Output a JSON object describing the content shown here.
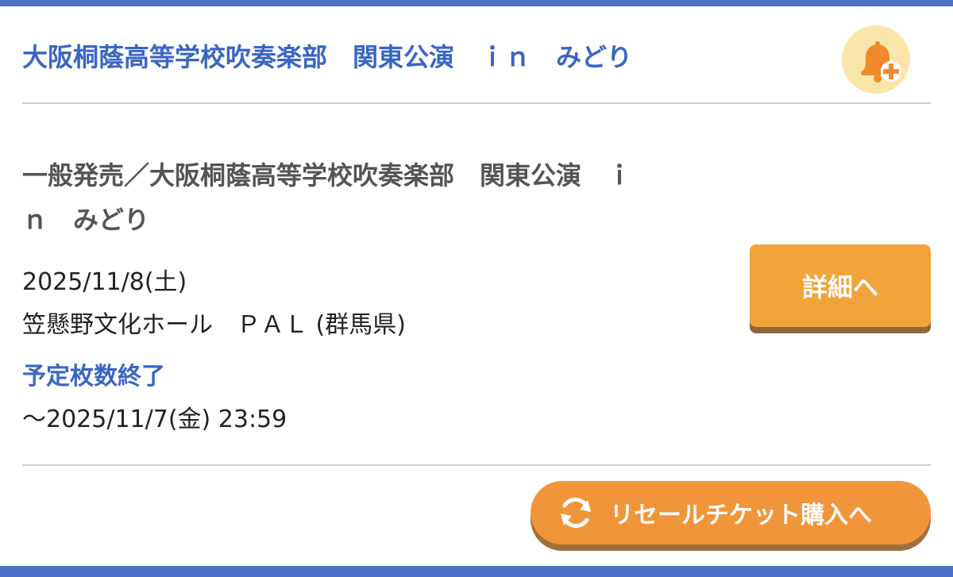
{
  "event": {
    "title": "大阪桐蔭高等学校吹奏楽部　関東公演　ｉｎ　みどり",
    "sale_title": "一般発売／大阪桐蔭高等学校吹奏楽部　関東公演　ｉ\nｎ　みどり",
    "date": "2025/11/8(土)",
    "venue": "笠懸野文化ホール　ＰＡＬ (群馬県)",
    "status": "予定枚数終了",
    "sale_end": "〜2025/11/7(金) 23:59"
  },
  "buttons": {
    "detail_label": "詳細へ",
    "resale_label": "リセールチケット購入へ"
  },
  "icons": {
    "bell": "bell-plus-icon",
    "refresh": "refresh-icon"
  },
  "colors": {
    "brand_blue": "#3a66c4",
    "orange": "#f0a43a",
    "resale_orange": "#f1953a",
    "bell_bg": "#fbe6a9"
  }
}
